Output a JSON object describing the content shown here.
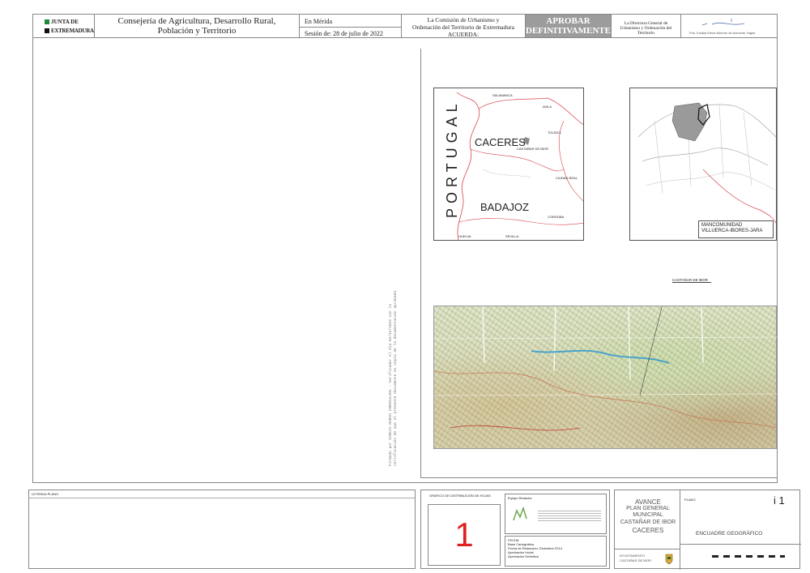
{
  "header": {
    "logo_line1": "JUNTA DE",
    "logo_line2": "EXTREMADURA",
    "consejeria_line1": "Consejería de Agricultura, Desarrollo Rural,",
    "consejeria_line2": "Población y Territorio",
    "place": "En Mérida",
    "session": "Sesión de: 28 de julio de 2022",
    "commission_line1": "La Comisión de Urbanismo y",
    "commission_line2": "Ordenación del Territorio de Extremadura",
    "commission_line3": "ACUERDA:",
    "stamp_line1": "APROBAR",
    "stamp_line2": "DEFINITIVAMENTE",
    "director_line1": "La Directora General de",
    "director_line2": "Urbanismo y Ordenación del Territorio",
    "signatory": "Fdo. Eulalia Elena Moreno de Acevedo Yagüe"
  },
  "map_region": {
    "country_label": "PORTUGAL",
    "provinces": [
      "CACERES",
      "BADAJOZ"
    ],
    "neighbors": [
      "SALAMANCA",
      "AVILA",
      "TOLEDO",
      "CIUDAD REAL",
      "CORDOBA",
      "SEVILLA",
      "HUELVA"
    ],
    "town_label": "CASTAÑAR DE IBOR"
  },
  "map_comarca": {
    "legend_line1": "MANCOMUNIDAD",
    "legend_line2": "VILLUERCA-IBORES-JARA"
  },
  "topo": {
    "callout": "CASTAÑAR DE IBOR"
  },
  "vertical_note": "Firmado por GARCIA RUBIO INMACULADA - Verificador el día 02/12/2022 con la certificación de que el presente documento es copia de la documentación aprobada",
  "footer": {
    "legend_title": "LEYENDA PLANO",
    "distribution_title": "GRÁFICO DE DISTRIBUCIÓN DE HOJAS",
    "sheet_number": "1",
    "team_title": "Equipo Redactor",
    "fecha_title": "FECHA",
    "fecha_lines": [
      "Base Cartográfica",
      "Fecha de Redacción: Diciembre 2014",
      "Aprobación Inicial",
      "Aprobación Definitiva"
    ],
    "project_line1": "AVANCE",
    "project_line2": "PLAN GENERAL",
    "project_line3": "MUNICIPAL",
    "project_line4": "CASTAÑAR DE IBOR",
    "project_line5": "CACERES",
    "ayto_line1": "AYUNTAMIENTO",
    "ayto_line2": "CASTAÑAR DE IBOR",
    "plano_label": "PLANO",
    "plano_title": "ENCUADRE GEOGRÁFICO",
    "plano_number": "i 1"
  },
  "colors": {
    "logo_green": "#1f8a3c",
    "stamp_gray": "#9c9c9c",
    "boundary_red": "#d9434b",
    "sheet_red": "#e02020"
  }
}
